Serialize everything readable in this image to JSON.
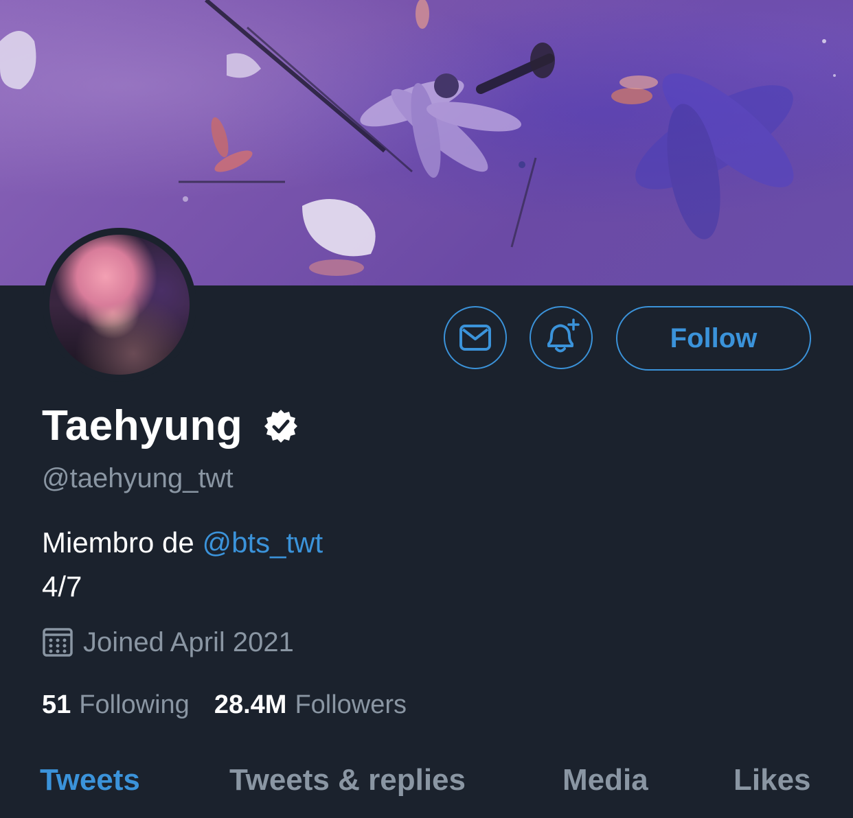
{
  "profile": {
    "display_name": "Taehyung",
    "handle": "@taehyung_twt",
    "verified": true,
    "bio_line1_prefix": "Miembro de",
    "bio_mention": "@bts_twt",
    "bio_line2": "4/7",
    "joined": "Joined April 2021",
    "following_count": "51",
    "following_label": "Following",
    "followers_count": "28.4M",
    "followers_label": "Followers"
  },
  "actions": {
    "follow_label": "Follow",
    "message_icon": "mail-icon",
    "notify_icon": "bell-plus-icon"
  },
  "tabs": [
    {
      "label": "Tweets",
      "active": true
    },
    {
      "label": "Tweets & replies",
      "active": false
    },
    {
      "label": "Media",
      "active": false
    },
    {
      "label": "Likes",
      "active": false
    }
  ],
  "colors": {
    "background": "#1b222d",
    "accent": "#3b93da",
    "text_primary": "#ffffff",
    "text_secondary": "#8a96a3",
    "banner": "#7a55ad"
  }
}
